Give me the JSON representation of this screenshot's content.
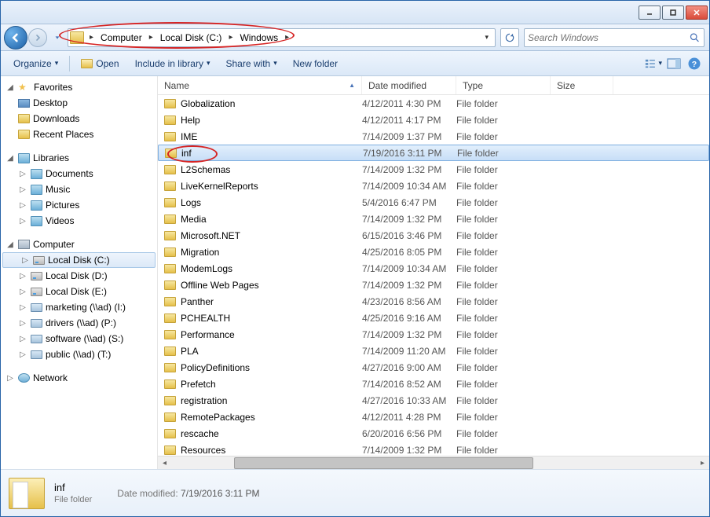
{
  "titlebar": {},
  "breadcrumb": {
    "segments": [
      "Computer",
      "Local Disk (C:)",
      "Windows"
    ]
  },
  "search": {
    "placeholder": "Search Windows"
  },
  "toolbar": {
    "organize": "Organize",
    "open": "Open",
    "include": "Include in library",
    "share": "Share with",
    "newfolder": "New folder"
  },
  "sidebar": {
    "favorites": {
      "label": "Favorites",
      "items": [
        "Desktop",
        "Downloads",
        "Recent Places"
      ]
    },
    "libraries": {
      "label": "Libraries",
      "items": [
        "Documents",
        "Music",
        "Pictures",
        "Videos"
      ]
    },
    "computer": {
      "label": "Computer",
      "items": [
        "Local Disk (C:)",
        "Local Disk (D:)",
        "Local Disk (E:)",
        "marketing (\\\\ad) (I:)",
        "drivers (\\\\ad) (P:)",
        "software (\\\\ad) (S:)",
        "public (\\\\ad) (T:)"
      ],
      "selected": 0
    },
    "network": {
      "label": "Network"
    }
  },
  "columns": {
    "name": "Name",
    "date": "Date modified",
    "type": "Type",
    "size": "Size"
  },
  "type_label": "File folder",
  "files": [
    {
      "name": "Globalization",
      "date": "4/12/2011 4:30 PM"
    },
    {
      "name": "Help",
      "date": "4/12/2011 4:17 PM"
    },
    {
      "name": "IME",
      "date": "7/14/2009 1:37 PM"
    },
    {
      "name": "inf",
      "date": "7/19/2016 3:11 PM",
      "selected": true
    },
    {
      "name": "L2Schemas",
      "date": "7/14/2009 1:32 PM"
    },
    {
      "name": "LiveKernelReports",
      "date": "7/14/2009 10:34 AM"
    },
    {
      "name": "Logs",
      "date": "5/4/2016 6:47 PM"
    },
    {
      "name": "Media",
      "date": "7/14/2009 1:32 PM"
    },
    {
      "name": "Microsoft.NET",
      "date": "6/15/2016 3:46 PM"
    },
    {
      "name": "Migration",
      "date": "4/25/2016 8:05 PM"
    },
    {
      "name": "ModemLogs",
      "date": "7/14/2009 10:34 AM"
    },
    {
      "name": "Offline Web Pages",
      "date": "7/14/2009 1:32 PM"
    },
    {
      "name": "Panther",
      "date": "4/23/2016 8:56 AM"
    },
    {
      "name": "PCHEALTH",
      "date": "4/25/2016 9:16 AM"
    },
    {
      "name": "Performance",
      "date": "7/14/2009 1:32 PM"
    },
    {
      "name": "PLA",
      "date": "7/14/2009 11:20 AM"
    },
    {
      "name": "PolicyDefinitions",
      "date": "4/27/2016 9:00 AM"
    },
    {
      "name": "Prefetch",
      "date": "7/14/2016 8:52 AM"
    },
    {
      "name": "registration",
      "date": "4/27/2016 10:33 AM"
    },
    {
      "name": "RemotePackages",
      "date": "4/12/2011 4:28 PM"
    },
    {
      "name": "rescache",
      "date": "6/20/2016 6:56 PM"
    },
    {
      "name": "Resources",
      "date": "7/14/2009 1:32 PM"
    }
  ],
  "details": {
    "name": "inf",
    "type": "File folder",
    "meta_label": "Date modified:",
    "meta_value": "7/19/2016 3:11 PM"
  }
}
